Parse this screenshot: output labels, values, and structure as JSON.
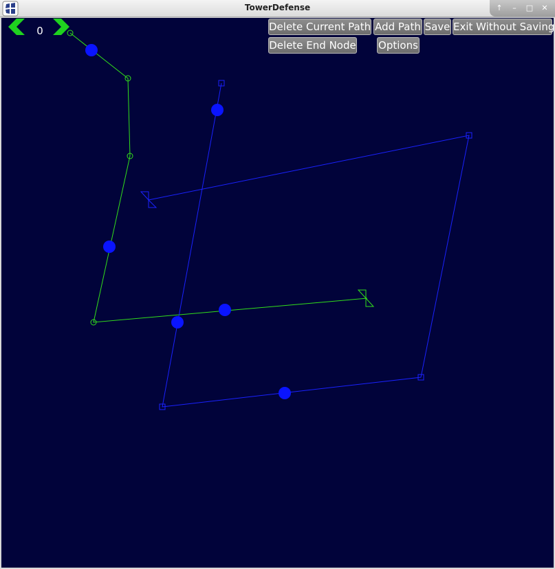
{
  "window": {
    "title": "TowerDefense",
    "controls": [
      "↑",
      "–",
      "□",
      "✕"
    ]
  },
  "toolbar": {
    "counter": "0",
    "buttons": {
      "delete_current_path": "Delete Current Path",
      "add_path": "Add Path",
      "save": "Save",
      "exit_without_saving": "Exit Without Saving",
      "delete_end_node": "Delete End Node",
      "options": "Options"
    }
  },
  "colors": {
    "background": "#01033a",
    "green_path": "#33e01a",
    "blue_path": "#1a22ff",
    "node_dot": "#0a14ff",
    "arrow": "#1fd21f"
  }
}
